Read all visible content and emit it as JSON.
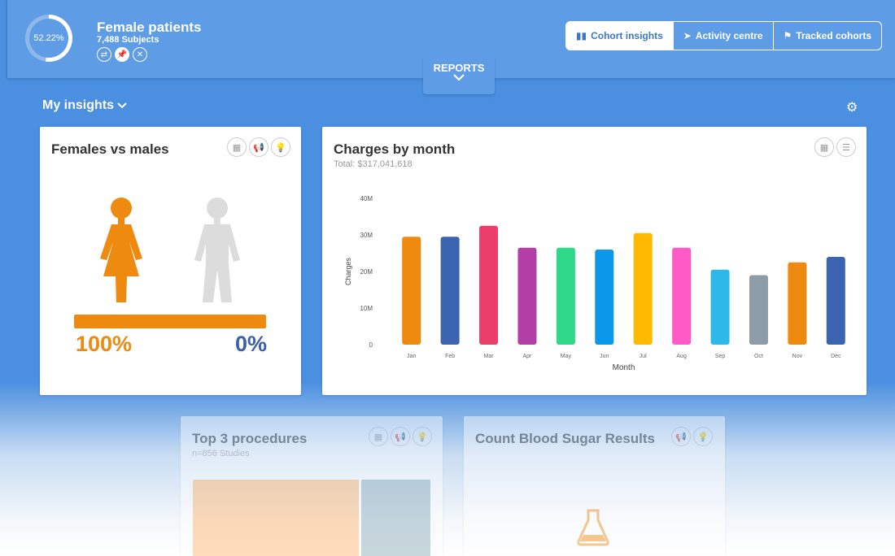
{
  "cohort": {
    "percent_label": "52.22%",
    "percent": 52.22,
    "title": "Female patients",
    "subjects": "7,488 Subjects",
    "actions": [
      "swap-icon",
      "pin-icon",
      "close-icon"
    ]
  },
  "nav": {
    "cohort_insights": "Cohort insights",
    "activity_centre": "Activity centre",
    "tracked_cohorts": "Tracked cohorts"
  },
  "reports": {
    "label": "REPORTS"
  },
  "insights": {
    "label": "My insights"
  },
  "females_vs_males": {
    "title": "Females vs males",
    "female_pct": "100%",
    "male_pct": "0%",
    "female_color": "#ee8a0f",
    "male_color": "#3b5fa8"
  },
  "charges": {
    "title": "Charges by month",
    "total": "Total: $317,041,618"
  },
  "top_procedures": {
    "title": "Top 3 procedures",
    "subtitle": "n=856 Studies"
  },
  "blood_sugar": {
    "title": "Count Blood Sugar Results"
  },
  "chart_data": {
    "type": "bar",
    "categories": [
      "Jan",
      "Feb",
      "Mar",
      "Apr",
      "May",
      "Jun",
      "Jul",
      "Aug",
      "Sep",
      "Oct",
      "Nov",
      "Dec"
    ],
    "values": [
      29.5,
      29.5,
      32.5,
      26.5,
      26.5,
      26,
      30.5,
      26.5,
      20.5,
      19,
      22.5,
      24
    ],
    "colors": [
      "#ee8a0f",
      "#3b64b0",
      "#ec3e6a",
      "#b23ea6",
      "#2ed888",
      "#0c98e8",
      "#ffb900",
      "#ff5bc6",
      "#2cb8e8",
      "#8c9ca8",
      "#ee8a0f",
      "#3b64b0"
    ],
    "xlabel": "Month",
    "ylabel": "Charges",
    "yticks": [
      "0",
      "10M",
      "20M",
      "30M",
      "40M"
    ],
    "ylim": [
      0,
      40
    ]
  }
}
